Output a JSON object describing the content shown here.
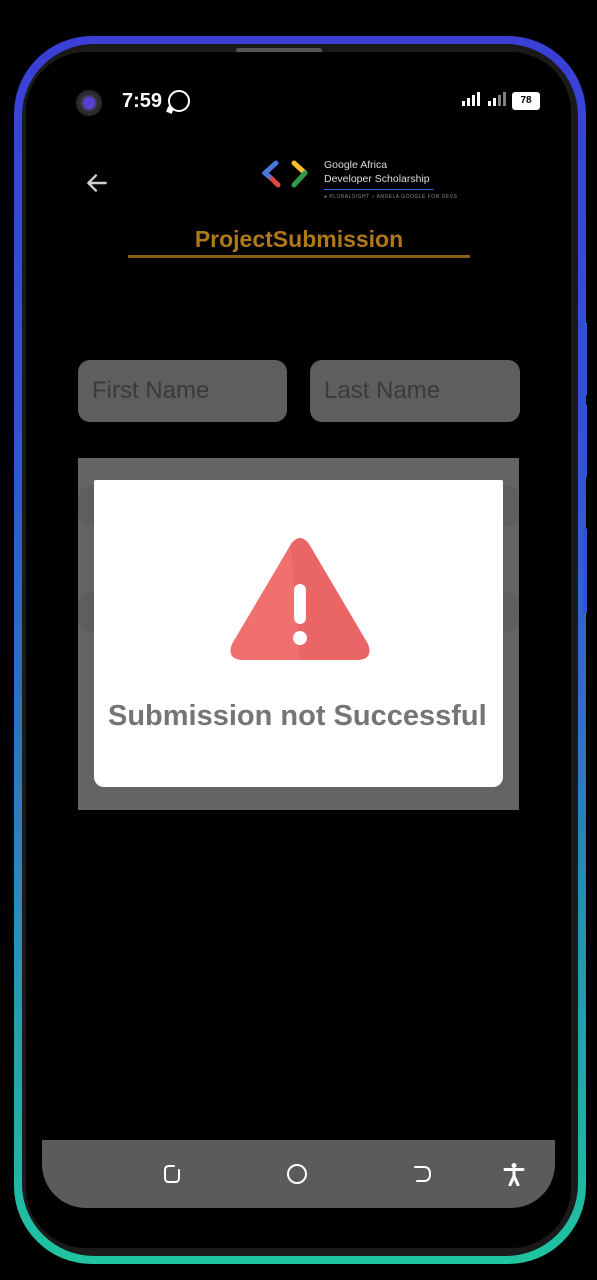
{
  "status_bar": {
    "time": "7:59",
    "battery": "78",
    "icons": [
      "camera-icon",
      "whatsapp-icon",
      "signal-icon",
      "battery-icon"
    ]
  },
  "header": {
    "back_icon": "arrow-left-icon",
    "logo_line1": "Google Africa",
    "logo_line2": "Developer Scholarship",
    "logo_partners": "● PLURALSIGHT   ○ ANDELA   GOOGLE FOR DEVS",
    "title": "ProjectSubmission"
  },
  "form": {
    "first_name_placeholder": "First Name",
    "last_name_placeholder": "Last Name"
  },
  "dialog": {
    "icon": "warning-triangle-icon",
    "message": "Submission not Successful"
  },
  "nav_bar": {
    "icons": [
      "recents-icon",
      "home-icon",
      "back-icon",
      "accessibility-icon"
    ]
  },
  "colors": {
    "title": "#b07918",
    "warning": "#f07070",
    "overlay": "#646464"
  }
}
